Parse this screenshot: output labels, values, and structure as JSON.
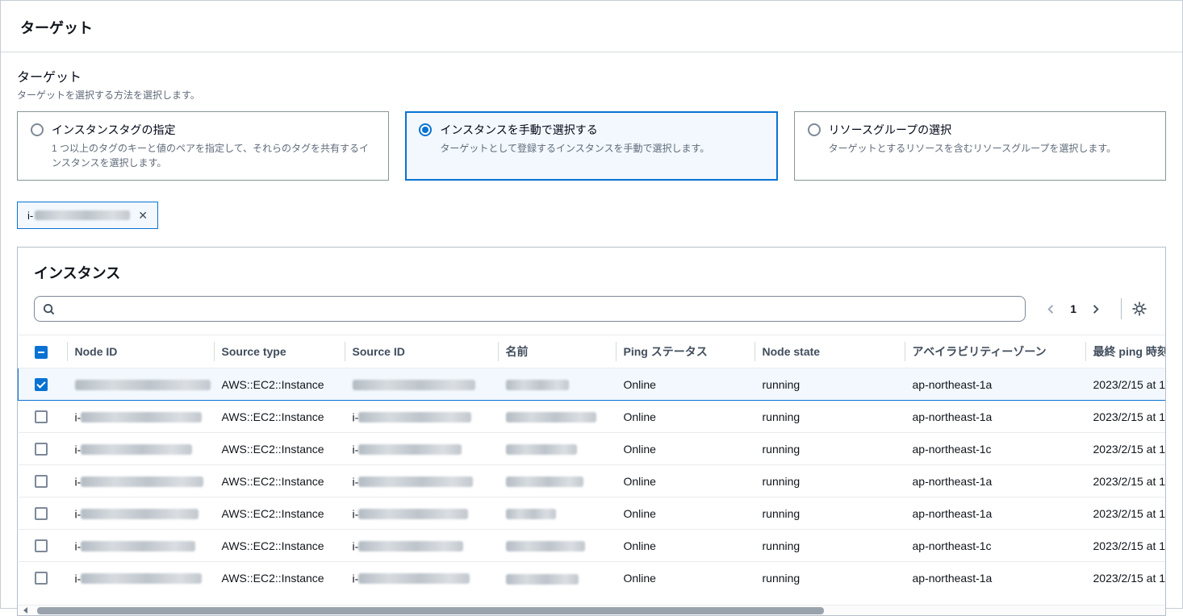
{
  "page": {
    "title": "ターゲット"
  },
  "colors": {
    "accent": "#0972d3",
    "selected_bg": "#f2f8fd"
  },
  "target_section": {
    "label": "ターゲット",
    "description": "ターゲットを選択する方法を選択します。",
    "options": [
      {
        "label": "インスタンスタグの指定",
        "description": "1 つ以上のタグのキーと値のペアを指定して、それらのタグを共有するインスタンスを選択します。",
        "selected": false
      },
      {
        "label": "インスタンスを手動で選択する",
        "description": "ターゲットとして登録するインスタンスを手動で選択します。",
        "selected": true
      },
      {
        "label": "リソースグループの選択",
        "description": "ターゲットとするリソースを含むリソースグループを選択します。",
        "selected": false
      }
    ]
  },
  "filter_chip": {
    "prefix": "i-",
    "value_redacted": true,
    "close_icon": "✕"
  },
  "instances_panel": {
    "title": "インスタンス",
    "search": {
      "placeholder": ""
    },
    "pagination": {
      "current_page": "1"
    },
    "icons": {
      "search": "search-icon",
      "settings": "gear-icon",
      "prev": "chevron-left-icon",
      "next": "chevron-right-icon"
    },
    "table": {
      "columns": [
        "Node ID",
        "Source type",
        "Source ID",
        "名前",
        "Ping ステータス",
        "Node state",
        "アベイラビリティーゾーン",
        "最終 ping 時刻"
      ],
      "rows": [
        {
          "selected": true,
          "node_id_prefix": "",
          "source_type": "AWS::EC2::Instance",
          "source_id_prefix": "",
          "name_redacted": true,
          "ping_status": "Online",
          "node_state": "running",
          "availability_zone": "ap-northeast-1a",
          "last_ping_time": "2023/2/15 at 1"
        },
        {
          "selected": false,
          "node_id_prefix": "i-",
          "source_type": "AWS::EC2::Instance",
          "source_id_prefix": "i-",
          "name_redacted": true,
          "ping_status": "Online",
          "node_state": "running",
          "availability_zone": "ap-northeast-1a",
          "last_ping_time": "2023/2/15 at 1"
        },
        {
          "selected": false,
          "node_id_prefix": "i-",
          "source_type": "AWS::EC2::Instance",
          "source_id_prefix": "i-",
          "name_redacted": true,
          "ping_status": "Online",
          "node_state": "running",
          "availability_zone": "ap-northeast-1c",
          "last_ping_time": "2023/2/15 at 1"
        },
        {
          "selected": false,
          "node_id_prefix": "i-",
          "source_type": "AWS::EC2::Instance",
          "source_id_prefix": "i-",
          "name_redacted": true,
          "ping_status": "Online",
          "node_state": "running",
          "availability_zone": "ap-northeast-1a",
          "last_ping_time": "2023/2/15 at 1"
        },
        {
          "selected": false,
          "node_id_prefix": "i-",
          "source_type": "AWS::EC2::Instance",
          "source_id_prefix": "i-",
          "name_redacted": true,
          "ping_status": "Online",
          "node_state": "running",
          "availability_zone": "ap-northeast-1a",
          "last_ping_time": "2023/2/15 at 1"
        },
        {
          "selected": false,
          "node_id_prefix": "i-",
          "source_type": "AWS::EC2::Instance",
          "source_id_prefix": "i-",
          "name_redacted": true,
          "ping_status": "Online",
          "node_state": "running",
          "availability_zone": "ap-northeast-1c",
          "last_ping_time": "2023/2/15 at 1"
        },
        {
          "selected": false,
          "node_id_prefix": "i-",
          "source_type": "AWS::EC2::Instance",
          "source_id_prefix": "i-",
          "name_redacted": true,
          "ping_status": "Online",
          "node_state": "running",
          "availability_zone": "ap-northeast-1a",
          "last_ping_time": "2023/2/15 at 1"
        }
      ]
    }
  }
}
